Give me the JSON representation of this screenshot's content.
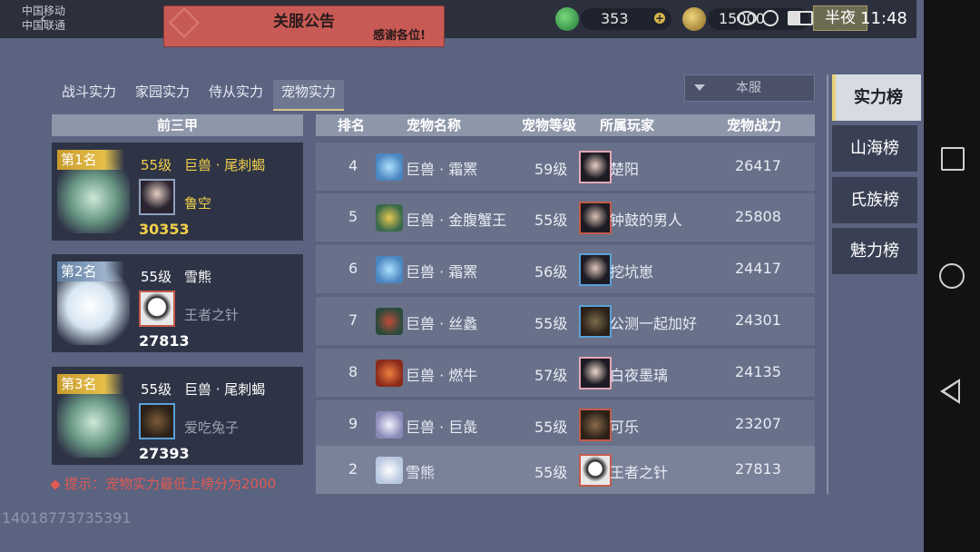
{
  "status_bar": {
    "carrier_1": "中国移动",
    "carrier_2": "中国联通",
    "jade_value": "353",
    "gold_value": "15000",
    "time": "11:48",
    "half_night": "半夜",
    "colors": {
      "bar": "#2c303c",
      "accent": "#d7c48a"
    }
  },
  "announcement": {
    "title": "关服公告",
    "subtitle": "感谢各位!"
  },
  "tabs": [
    {
      "label": "战斗实力"
    },
    {
      "label": "家园实力"
    },
    {
      "label": "侍从实力"
    },
    {
      "label": "宠物实力",
      "active": true
    }
  ],
  "server_filter": {
    "value": "本服"
  },
  "top3": {
    "header": "前三甲",
    "cards": [
      {
        "rank": "第1名",
        "level": "55级",
        "pet": "巨兽 · 尾刺蝎",
        "owner": "鲁空",
        "power": "30353"
      },
      {
        "rank": "第2名",
        "level": "55级",
        "pet": "雪熊",
        "owner": "王者之针",
        "power": "27813"
      },
      {
        "rank": "第3名",
        "level": "55级",
        "pet": "巨兽 · 尾刺蝎",
        "owner": "爱吃兔子",
        "power": "27393"
      }
    ],
    "hint": "提示：宠物实力最低上榜分为2000"
  },
  "table": {
    "headers": {
      "rank": "排名",
      "pet": "宠物名称",
      "level": "宠物等级",
      "owner": "所属玩家",
      "power": "宠物战力"
    },
    "rows": [
      {
        "rank": "4",
        "pet": "巨兽 · 霜罴",
        "level": "59级",
        "owner": "楚阳",
        "power": "26417"
      },
      {
        "rank": "5",
        "pet": "巨兽 · 金腹蟹王",
        "level": "55级",
        "owner": "钟鼓的男人",
        "power": "25808"
      },
      {
        "rank": "6",
        "pet": "巨兽 · 霜罴",
        "level": "56级",
        "owner": "挖坑崽",
        "power": "24417"
      },
      {
        "rank": "7",
        "pet": "巨兽 · 丝蠡",
        "level": "55级",
        "owner": "公测一起加好",
        "power": "24301"
      },
      {
        "rank": "8",
        "pet": "巨兽 · 燃牛",
        "level": "57级",
        "owner": "白夜墨璃",
        "power": "24135"
      },
      {
        "rank": "9",
        "pet": "巨兽 · 巨彘",
        "level": "55级",
        "owner": "可乐",
        "power": "23207"
      }
    ],
    "self_row": {
      "rank": "2",
      "pet": "雪熊",
      "level": "55级",
      "owner": "王者之针",
      "power": "27813"
    }
  },
  "side_tabs": [
    {
      "label": "实力榜",
      "active": true
    },
    {
      "label": "山海榜"
    },
    {
      "label": "氏族榜"
    },
    {
      "label": "魅力榜"
    }
  ],
  "player_id": "14018773735391"
}
